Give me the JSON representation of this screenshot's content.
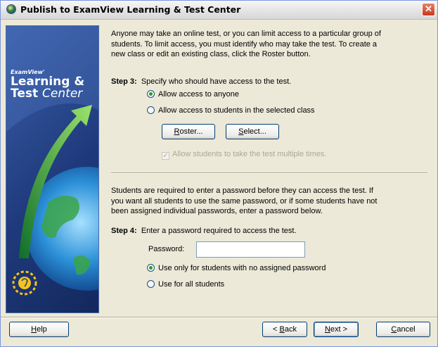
{
  "window": {
    "title": "Publish to ExamView Learning & Test Center",
    "close_glyph": "✕"
  },
  "sidebar": {
    "logo_small": "ExamView'",
    "logo_line1": "Learning &",
    "logo_line2_bold": "Test",
    "logo_line2_italic": "Center"
  },
  "intro": {
    "lines": [
      "Anyone may take an online test, or you can limit access to a particular group of",
      "students.  To limit access, you must identify who may take the test.  To create a",
      "new class or edit an existing class, click the Roster button."
    ]
  },
  "step3": {
    "label": "Step 3:",
    "text": "Specify who should have access to the test.",
    "options": [
      {
        "label": "Allow access to anyone",
        "checked": true
      },
      {
        "label": "Allow access to students in the selected class",
        "checked": false
      }
    ],
    "roster_button": {
      "mnemonic": "R",
      "rest": "oster..."
    },
    "select_button": {
      "mnemonic": "S",
      "rest": "elect..."
    },
    "multiple_times": {
      "label": "Allow students to take the test multiple times.",
      "checked": true,
      "enabled": false
    }
  },
  "password_section": {
    "lines": [
      "Students are required to enter a password before they can access the test.  If",
      "you want all students to use the same password, or if some students have not",
      "been assigned individual passwords, enter a password below."
    ]
  },
  "step4": {
    "label": "Step 4:",
    "text": "Enter a password required to access the test.",
    "password_label": "Password:",
    "password_value": "",
    "options": [
      {
        "label": "Use only for students with no assigned password",
        "checked": true
      },
      {
        "label": "Use for all students",
        "checked": false
      }
    ]
  },
  "footer": {
    "help": {
      "mnemonic": "H",
      "rest": "elp"
    },
    "back": {
      "prefix": "< ",
      "mnemonic": "B",
      "rest": "ack"
    },
    "next": {
      "mnemonic": "N",
      "rest": "ext >"
    },
    "cancel": {
      "mnemonic": "C",
      "rest": "ancel"
    }
  },
  "colors": {
    "sidebar_blue": "#1f3a7c",
    "radio_dot": "#21a121",
    "button_border": "#003c74",
    "close_red": "#c9381b"
  }
}
